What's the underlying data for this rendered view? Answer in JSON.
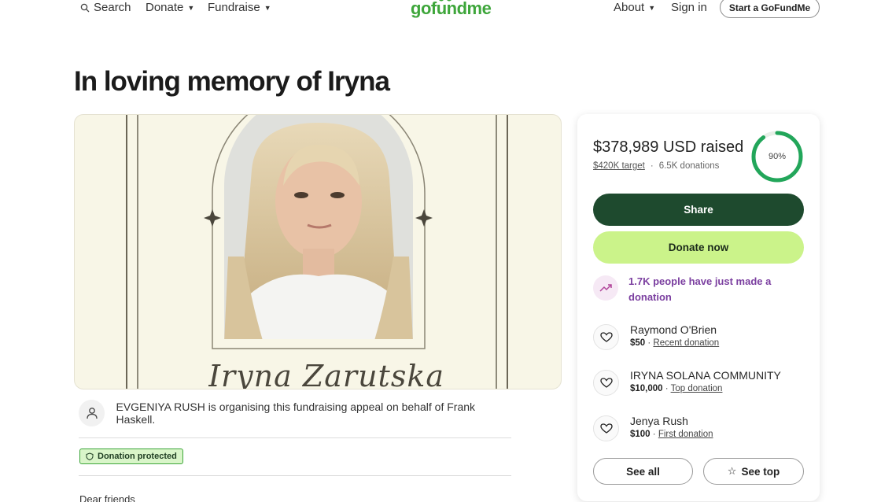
{
  "nav": {
    "search": "Search",
    "donate": "Donate",
    "fundraise": "Fundraise",
    "logo": "gofundme",
    "about": "About",
    "sign_in": "Sign in",
    "start": "Start a GoFundMe"
  },
  "page": {
    "title": "In loving memory of Iryna",
    "hero_name": "Iryna Zarutska"
  },
  "organiser": {
    "text": "EVGENIYA RUSH is organising this fundraising appeal on behalf of Frank Haskell."
  },
  "badge": {
    "label": "Donation protected"
  },
  "story": {
    "opening": "Dear friends"
  },
  "campaign": {
    "raised": "$378,989 USD raised",
    "target": "$420K target",
    "separator": "·",
    "donations": "6.5K donations",
    "progress_label": "90%",
    "progress": 0.9,
    "share": "Share",
    "donate_now": "Donate now",
    "trend": "1.7K people have just made a donation"
  },
  "donors": [
    {
      "name": "Raymond O'Brien",
      "amount": "$50",
      "sep": " · ",
      "tag": "Recent donation"
    },
    {
      "name": "IRYNA SOLANA COMMUNITY",
      "amount": "$10,000",
      "sep": " · ",
      "tag": "Top donation"
    },
    {
      "name": "Jenya Rush",
      "amount": "$100",
      "sep": " · ",
      "tag": "First donation"
    }
  ],
  "actions": {
    "see_all": "See all",
    "see_top": "See top"
  },
  "colors": {
    "brand_green": "#3ea63b",
    "share_bg": "#1e4a2e",
    "donate_bg": "#cbf38a",
    "trend_purple": "#7b3fa0",
    "progress_ring": "#22a65a"
  }
}
